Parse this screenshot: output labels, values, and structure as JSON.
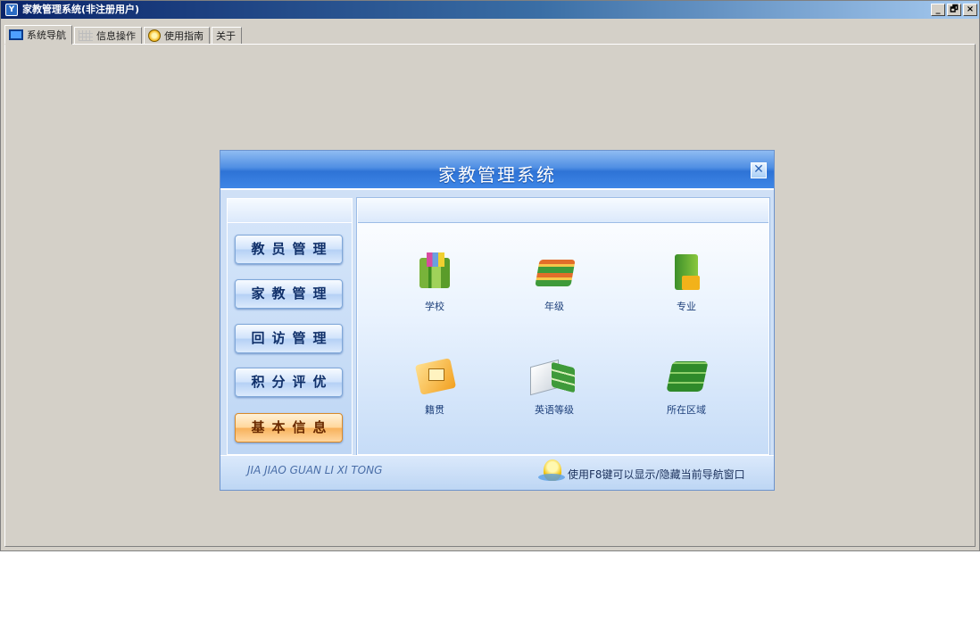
{
  "window": {
    "title": "家教管理系统(非注册用户)",
    "controls": [
      "_",
      "🗗",
      "×"
    ]
  },
  "tabs": [
    {
      "label": "系统导航",
      "icon": "monitor-icon",
      "active": true
    },
    {
      "label": "信息操作",
      "icon": "grid-icon",
      "active": false
    },
    {
      "label": "使用指南",
      "icon": "guide-icon",
      "active": false
    },
    {
      "label": "关于",
      "icon": "",
      "active": false
    }
  ],
  "nav": {
    "title": "家教管理系统",
    "close_glyph": "✕",
    "menu": [
      {
        "label": "教员管理"
      },
      {
        "label": "家教管理"
      },
      {
        "label": "回访管理"
      },
      {
        "label": "积分评优"
      },
      {
        "label": "基本信息"
      }
    ],
    "items": [
      {
        "label": "学校",
        "icon": "books-school-icon"
      },
      {
        "label": "年级",
        "icon": "books-grade-icon"
      },
      {
        "label": "专业",
        "icon": "books-major-icon"
      },
      {
        "label": "籍贯",
        "icon": "folder-origin-icon"
      },
      {
        "label": "英语等级",
        "icon": "book-english-icon"
      },
      {
        "label": "所在区域",
        "icon": "books-region-icon"
      }
    ],
    "footer": {
      "brand": "JIA JIAO GUAN LI XI TONG",
      "tip": "使用F8键可以显示/隐藏当前导航窗口"
    }
  },
  "colors": {
    "accent": "#2e73d6",
    "titlebar_start": "#0a246a",
    "titlebar_end": "#a6caf0",
    "highlight_button": "#f7b15a"
  }
}
